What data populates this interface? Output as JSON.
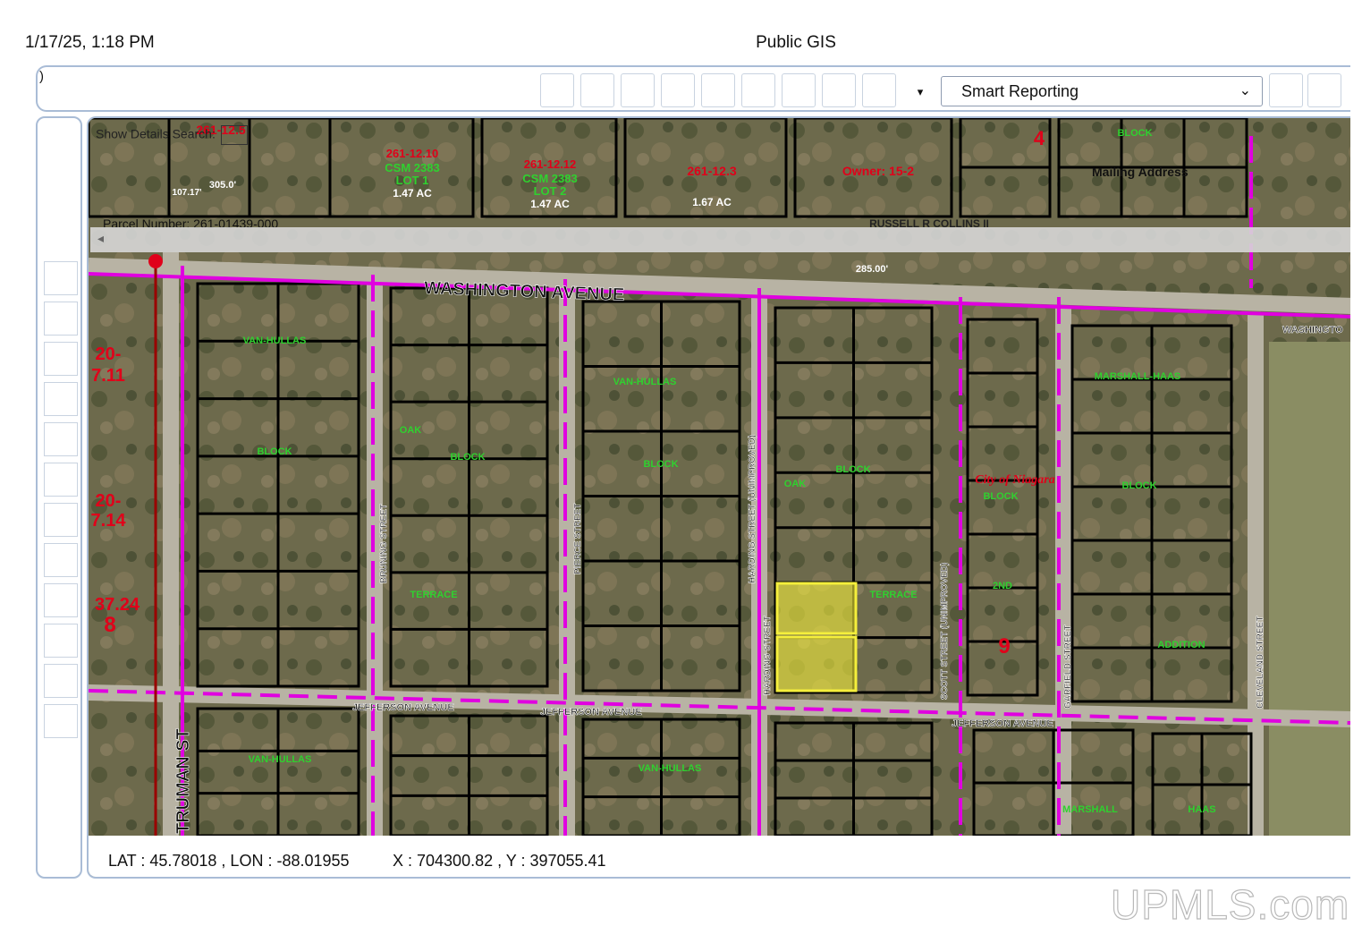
{
  "print_header": {
    "timestamp": "1/17/25, 1:18 PM",
    "title": "Public GIS"
  },
  "toolbar": {
    "paren": ")",
    "buttons": [
      "tool-1",
      "tool-2",
      "tool-3",
      "tool-4",
      "tool-5",
      "tool-6",
      "tool-7",
      "tool-8",
      "tool-9"
    ],
    "caret": "▾",
    "select_value": "Smart Reporting",
    "select_chevron": "⌄"
  },
  "map_overlay": {
    "search_label": "Show Details   Search:",
    "mailing_address": "Mailing Address",
    "parcel_number": "Parcel Number: 261-01439-000",
    "owner": "Owner: 15-2",
    "scroll_arrow": "◂"
  },
  "streets": {
    "washington": "WASHINGTON AVENUE",
    "washington_short": "WASHINGTO",
    "jefferson1": "JEFFERSON AVENUE",
    "jefferson2": "JEFFERSON AVENUE",
    "jefferson3": "JEFFERSON AVENUE",
    "truman": "TRUMAN ST",
    "bruning": "BRUNING STREET",
    "pierce": "PIERCE STREET",
    "harding_unimp": "HARDING STREET (UNIMPROVED)",
    "harding": "HARDING STREET",
    "scott": "SCOTT STREET (UNIMPROVED)",
    "garfield": "GARFIELD STREET",
    "cleveland": "CLEVELAND STREET"
  },
  "map_labels": {
    "parcel_a": "261-12.10",
    "csm_a": "CSM 2383",
    "lot_a": "LOT 1",
    "acre_a": "1.47 AC",
    "parcel_b": "261-12.12",
    "csm_b": "CSM 2383",
    "lot_b": "LOT 2",
    "acre_b": "1.47 AC",
    "parcel_c": "261-12.3",
    "acre_c": "1.67 AC",
    "parcel_d": "261-12.5",
    "left_big1": "20-",
    "left_big2": "7.11",
    "left_big3": "20-",
    "left_big4": "7.14",
    "left_big5": "37.24",
    "section_8": "8",
    "section_9": "9",
    "section_4": "4",
    "city": "City of Niagara",
    "russell": "RUSSELL R COLLINS II",
    "block": "BLOCK",
    "oak": "OAK",
    "terrace": "TERRACE",
    "vanhullas": "VAN-HULLAS",
    "marshall_haas": "MARSHALL-HAAS",
    "addition": "ADDITION",
    "second": "2ND",
    "marshall": "MARSHALL",
    "haas": "HAAS",
    "dim_a": "305.0'",
    "dim_b": "285.00'",
    "dim_c": "107.17'"
  },
  "coords": {
    "latlon": "LAT : 45.78018 , LON : -88.01955",
    "xy": "X : 704300.82 , Y : 397055.41"
  },
  "watermark": "UPMLS.com",
  "colors": {
    "accent_border": "#a9bcd6",
    "parcel_line": "#000000",
    "road_line": "#e000e0",
    "highlight": "#f5ef3c",
    "label_red": "#e0001a",
    "label_green": "#2fd12f"
  }
}
